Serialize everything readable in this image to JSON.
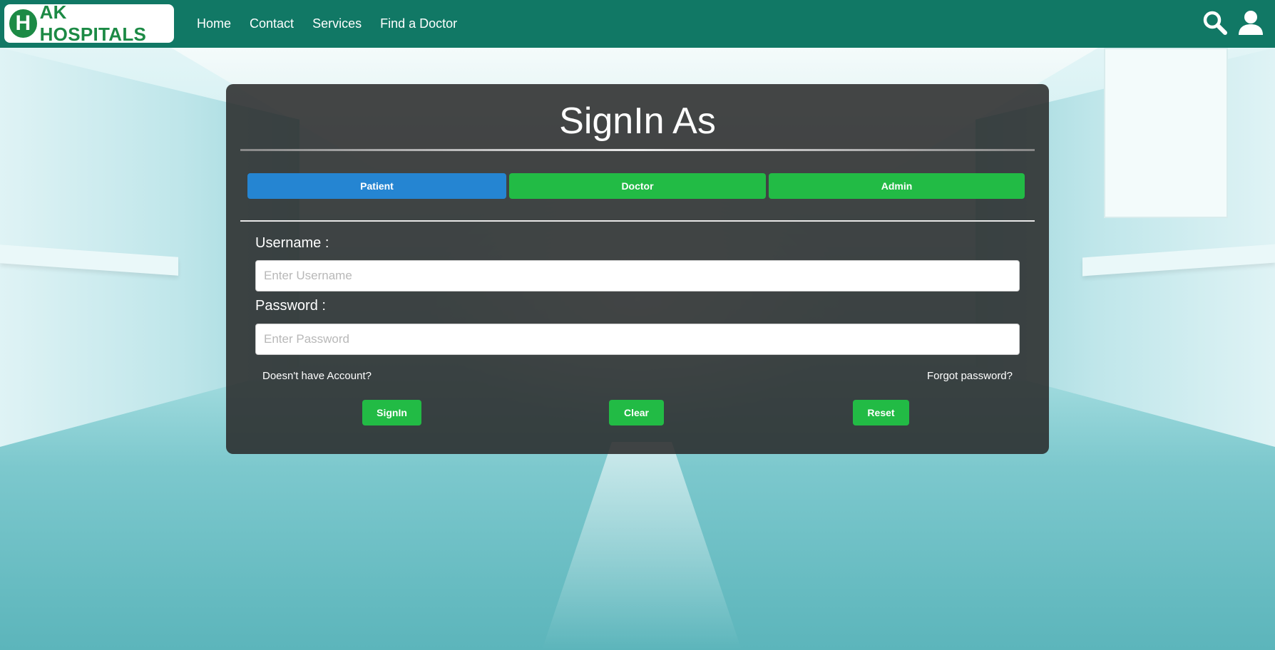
{
  "brand": {
    "logo_letter": "H",
    "name": "AK HOSPITALS"
  },
  "nav": {
    "links": [
      "Home",
      "Contact",
      "Services",
      "Find a Doctor"
    ],
    "icons": [
      "search-icon",
      "user-icon"
    ]
  },
  "signin": {
    "title": "SignIn As",
    "roles": [
      {
        "label": "Patient",
        "color": "#2585d2",
        "selected": true
      },
      {
        "label": "Doctor",
        "color": "#22bb45",
        "selected": false
      },
      {
        "label": "Admin",
        "color": "#22bb45",
        "selected": false
      }
    ],
    "username_label": "Username :",
    "username_placeholder": "Enter Username",
    "username_value": "",
    "password_label": "Password :",
    "password_placeholder": "Enter Password",
    "password_value": "",
    "no_account_link": "Doesn't have Account?",
    "forgot_link": "Forgot password?",
    "buttons": {
      "signin": "SignIn",
      "clear": "Clear",
      "reset": "Reset"
    }
  },
  "colors": {
    "navbar": "#117865",
    "accent_green": "#22bb45",
    "accent_blue": "#2585d2",
    "brand_green": "#1c8a45"
  }
}
